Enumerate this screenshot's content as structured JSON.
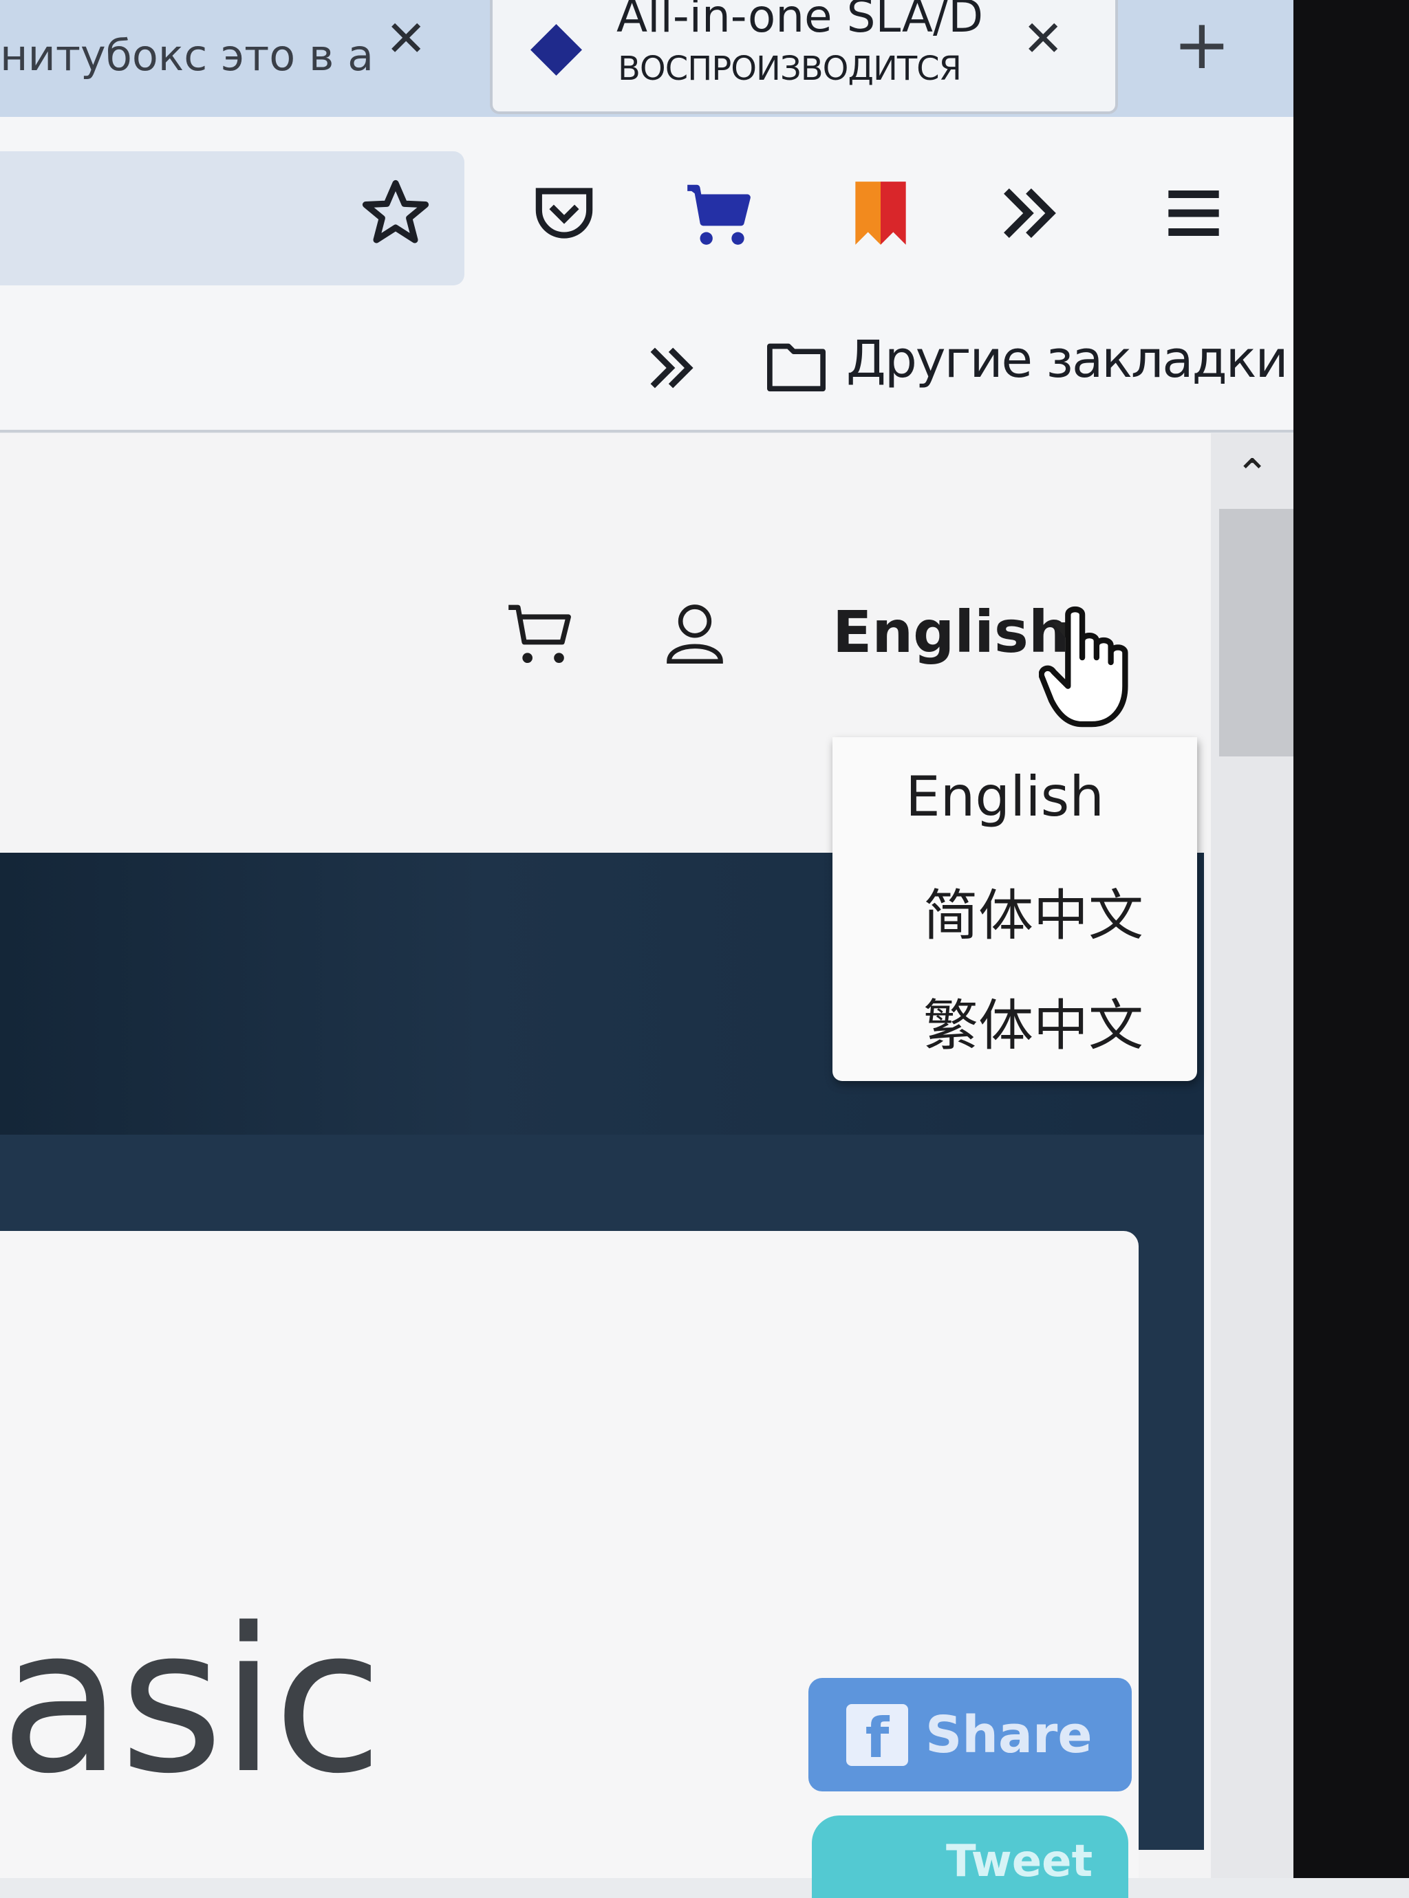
{
  "browser": {
    "tabs": [
      {
        "title": "нитубокс это в а"
      },
      {
        "title": "All-in-one SLA/D",
        "status": "ВОСПРОИЗВОДИТСЯ"
      }
    ],
    "new_tab_label": "+"
  },
  "bookmarks_bar": {
    "overflow_label": "»",
    "folder_label": "Другие закладки"
  },
  "site_header": {
    "language_current": "English",
    "language_options": [
      "English",
      "简体中文",
      "繁体中文"
    ]
  },
  "hero": {
    "text_fragment": "asic"
  },
  "social": {
    "share_label": "Share",
    "tweet_label": "Tweet"
  },
  "colors": {
    "tab_strip": "#c8d7ea",
    "hero_dark": "#20364d",
    "share_blue": "#5d95dc",
    "tweet_teal": "#53c9d2",
    "bookmark_orange": "#f28a1e",
    "bookmark_red": "#d9262a",
    "cart_blue": "#2430a6"
  }
}
